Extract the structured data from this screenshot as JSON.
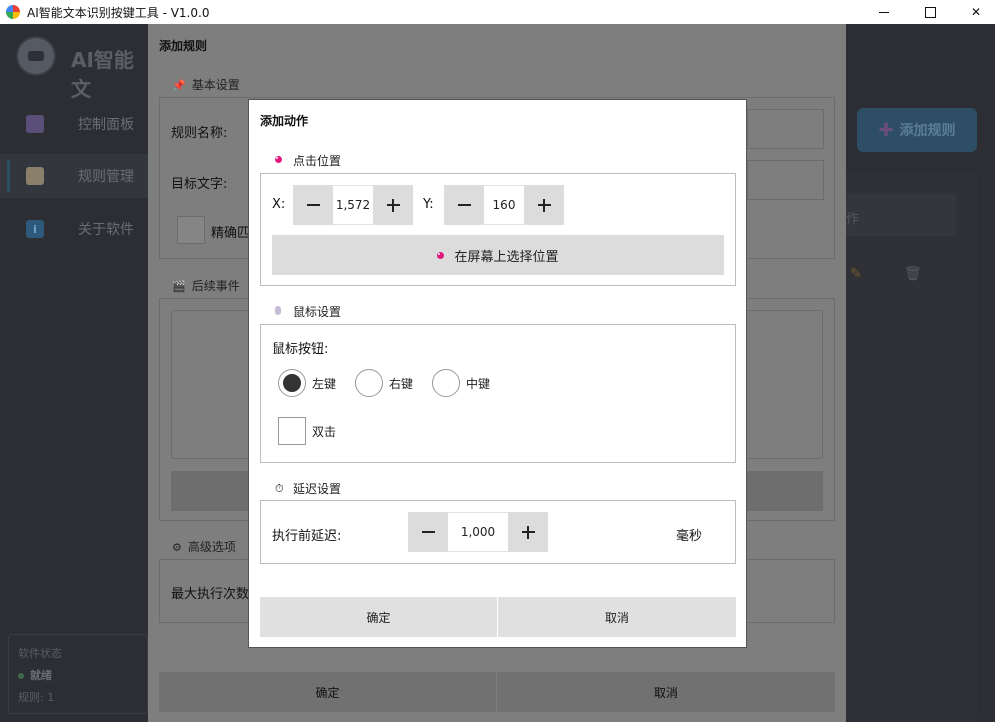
{
  "window": {
    "title": "AI智能文本识别按键工具 - V1.0.0"
  },
  "sidebar": {
    "app_name": "AI智能文",
    "items": [
      {
        "label": "控制面板"
      },
      {
        "label": "规则管理"
      },
      {
        "label": "关于软件"
      }
    ],
    "status": {
      "heading": "软件状态",
      "state": "就绪",
      "rules": "规则: 1"
    }
  },
  "main": {
    "add_rule_label": "添加规则",
    "column_partial": "作"
  },
  "rule_dialog": {
    "title": "添加规则",
    "basic_section": "基本设置",
    "rule_name_label": "规则名称:",
    "target_text_label": "目标文字:",
    "exact_match_label": "精确匹",
    "events_section": "后续事件",
    "advanced_section": "高级选项",
    "max_exec_label": "最大执行次数",
    "ok": "确定",
    "cancel": "取消"
  },
  "action_dialog": {
    "title": "添加动作",
    "click_position": {
      "section": "点击位置",
      "x_label": "X:",
      "x_value": "1,572",
      "y_label": "Y:",
      "y_value": "160",
      "pick_label": "在屏幕上选择位置"
    },
    "mouse": {
      "section": "鼠标设置",
      "button_label": "鼠标按钮:",
      "left": "左键",
      "right": "右键",
      "middle": "中键",
      "selected": "left",
      "double_click": "双击",
      "double_click_checked": false
    },
    "delay": {
      "section": "延迟设置",
      "label": "执行前延迟:",
      "value": "1,000",
      "unit": "毫秒"
    },
    "ok": "确定",
    "cancel": "取消"
  },
  "colors": {
    "accent_pink": "#e2197b",
    "primary_blue": "#2e4e66"
  }
}
